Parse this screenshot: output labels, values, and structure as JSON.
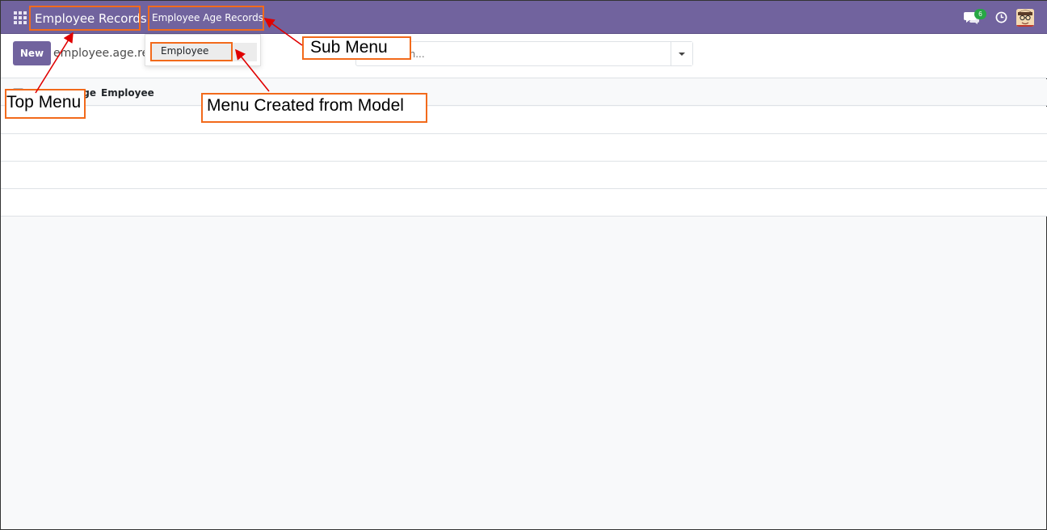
{
  "navbar": {
    "app_name": "Employee Records",
    "submenu": "Employee Age Records",
    "chat_badge": "6",
    "colors": {
      "primary": "#71639e",
      "badge": "#28a745"
    }
  },
  "dropdown": {
    "items": [
      {
        "label": "Employee"
      }
    ]
  },
  "control_panel": {
    "new_label": "New",
    "breadcrumb": "employee.age.record",
    "search_placeholder": "Search..."
  },
  "list": {
    "columns": [
      {
        "label": "Age"
      },
      {
        "label": "Employee"
      }
    ],
    "rows": []
  },
  "annotations": {
    "top_menu": "Top Menu",
    "sub_menu": "Sub Menu",
    "model_menu": "Menu Created from Model",
    "color": "#f26a1b",
    "arrow_color": "#e00000"
  }
}
